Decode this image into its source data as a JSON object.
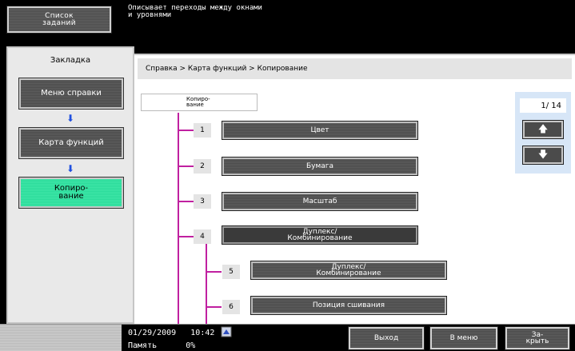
{
  "header": {
    "job_list_label": "Список\nзаданий",
    "message": "Описывает переходы между окнами\nи уровнями"
  },
  "sidebar": {
    "tab_label": "Закладка",
    "items": [
      {
        "label": "Меню справки"
      },
      {
        "label": "Карта функций"
      },
      {
        "label": "Копиро-\nвание"
      }
    ]
  },
  "main": {
    "breadcrumb": "Справка > Карта функций > Копирование",
    "root_label": "Копиро-\nвание",
    "tree": [
      {
        "num": "1",
        "label": "Цвет"
      },
      {
        "num": "2",
        "label": "Бумага"
      },
      {
        "num": "3",
        "label": "Масштаб"
      },
      {
        "num": "4",
        "label": "Дуплекс/\nКомбинирование"
      },
      {
        "num": "5",
        "label": "Дуплекс/\nКомбинирование"
      },
      {
        "num": "6",
        "label": "Позиция сшивания"
      }
    ],
    "pager": {
      "text": "1/ 14",
      "up": "🡅",
      "down": "🡇"
    }
  },
  "footer": {
    "date": "01/29/2009",
    "time": "10:42",
    "memory_label": "Память",
    "memory_value": "0%",
    "buttons": [
      "Выход",
      "В меню",
      "За-\nкрыть"
    ]
  },
  "colors": {
    "tree_line": "#c020a0",
    "active_button": "#3fe5a8",
    "arrow": "#1f4fe0"
  }
}
